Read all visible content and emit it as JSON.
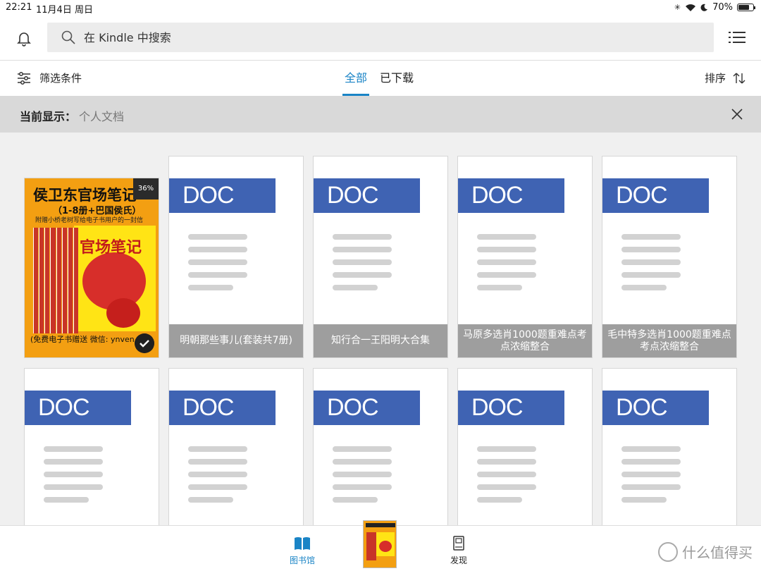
{
  "status_bar": {
    "time": "22:21",
    "date": "11月4日 周日",
    "battery": "70%"
  },
  "header": {
    "search_placeholder": "在 Kindle 中搜索"
  },
  "filter_bar": {
    "filter_label": "筛选条件",
    "tabs": [
      {
        "label": "全部",
        "active": true
      },
      {
        "label": "已下载",
        "active": false
      }
    ],
    "sort_label": "排序"
  },
  "banner": {
    "label": "当前显示：",
    "value": "个人文档"
  },
  "colors": {
    "accent": "#1a84c6",
    "doc_badge": "#3f63b3",
    "caption_bg": "#9e9e9e"
  },
  "library": {
    "cover_book": {
      "title": "侯卫东官场笔记",
      "subtitle": "（1-8册+巴国侯氏）",
      "tagline": "附赠小桥老树写给电子书用户的一封信",
      "inner_title": "官场笔记",
      "footer": "(免费电子书赠送 微信: ynven",
      "progress": "36%",
      "downloaded": true
    },
    "doc_label": "DOC",
    "row1_docs": [
      {
        "title": "明朝那些事儿(套装共7册)"
      },
      {
        "title": "知行合一王阳明大合集"
      },
      {
        "title": "马原多选肖1000题重难点考点浓缩整合"
      },
      {
        "title": "毛中特多选肖1000题重难点考点浓缩整合"
      }
    ]
  },
  "bottom_nav": {
    "library_label": "图书馆",
    "discover_label": "发现",
    "watermark": "什么值得买"
  }
}
